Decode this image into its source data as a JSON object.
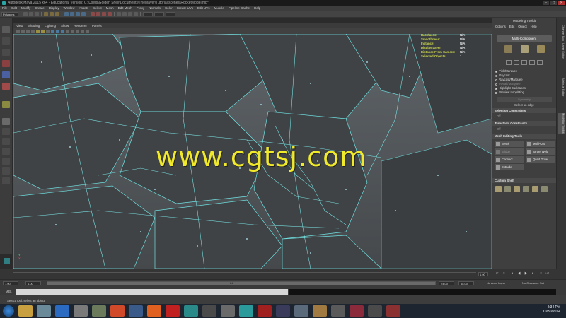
{
  "window": {
    "title": "Autodesk Maya 2015 x64 - Educational Version: C:\\Users\\Golden Shell\\Documents\\TheMayer\\Tutorial\\scenes\\RocketModel.mb*",
    "buttons": [
      "–",
      "□",
      "✕"
    ]
  },
  "menubar": [
    "File",
    "Edit",
    "Modify",
    "Create",
    "Display",
    "Window",
    "Assets",
    "Select",
    "Mesh",
    "Edit Mesh",
    "Proxy",
    "Normals",
    "Color",
    "Create UVs",
    "Edit UVs",
    "Muscle",
    "Pipeline Cache",
    "Help"
  ],
  "statusline": {
    "mode": "Polygons"
  },
  "panel_menu": [
    "View",
    "Shading",
    "Lighting",
    "Show",
    "Renderer",
    "Panels"
  ],
  "hud": [
    {
      "label": "Backfaces:",
      "value": "N/A"
    },
    {
      "label": "Smoothness:",
      "value": "N/A"
    },
    {
      "label": "Instance:",
      "value": "N/A"
    },
    {
      "label": "Display Layer:",
      "value": "N/A"
    },
    {
      "label": "Distance From Camera:",
      "value": "N/A"
    },
    {
      "label": "Selected Objects:",
      "value": "1"
    }
  ],
  "watermark": "www.cgtsj.com",
  "axis": {
    "y": "Y",
    "x": "X"
  },
  "tools_panel": {
    "title": "Modeling Toolkit",
    "menus": [
      "Options",
      "Edit",
      "Object",
      "Help"
    ],
    "multi_component": "Multi-Component",
    "pick_options": [
      {
        "label": "Pick/Marquee",
        "kind": "radio",
        "on": true,
        "dim": false
      },
      {
        "label": "Raycast",
        "kind": "radio",
        "on": false,
        "dim": false
      },
      {
        "label": "Raycast/Marquee",
        "kind": "radio",
        "on": false,
        "dim": false
      },
      {
        "label": "Tweak/Marquee",
        "kind": "radio",
        "on": false,
        "dim": true
      },
      {
        "label": "Highlight Backfaces",
        "kind": "check",
        "on": true,
        "dim": false
      },
      {
        "label": "Preview Loop/Ring",
        "kind": "check",
        "on": false,
        "dim": false
      }
    ],
    "symmetry": "Symmetry",
    "hint": "Select an edge",
    "selection_constraints": "Selection Constraints",
    "selection_constraints_value": "Off",
    "transform_constraints": "Transform Constraints",
    "transform_constraints_value": "Off",
    "mesh_editing_tools": "Mesh Editing Tools",
    "mesh_tools": [
      {
        "label": "Bevel",
        "enabled": true
      },
      {
        "label": "Multi-Cut",
        "enabled": true
      },
      {
        "label": "Bridge",
        "enabled": false
      },
      {
        "label": "Target Weld",
        "enabled": true
      },
      {
        "label": "Connect",
        "enabled": true
      },
      {
        "label": "Quad Draw",
        "enabled": true
      },
      {
        "label": "Extrude",
        "enabled": true
      }
    ],
    "custom_shelf": "Custom Shelf"
  },
  "side_tabs": [
    "Channel Box / Layer Editor",
    "Attribute Editor",
    "Modeling Toolkit"
  ],
  "time_slider": {
    "current_frame": "1.00",
    "range_start": "1.00",
    "range_start_2": "1.00",
    "playback_end": "24.00",
    "anim_end": "48.00",
    "range_label": "24",
    "anim_layer": "No Anim Layer",
    "char_set": "No Character Set"
  },
  "command": {
    "label": "MEL"
  },
  "help_line": "Select Tool: select an object",
  "taskbar": {
    "time": "4:34 PM",
    "date": "10/30/2014"
  }
}
